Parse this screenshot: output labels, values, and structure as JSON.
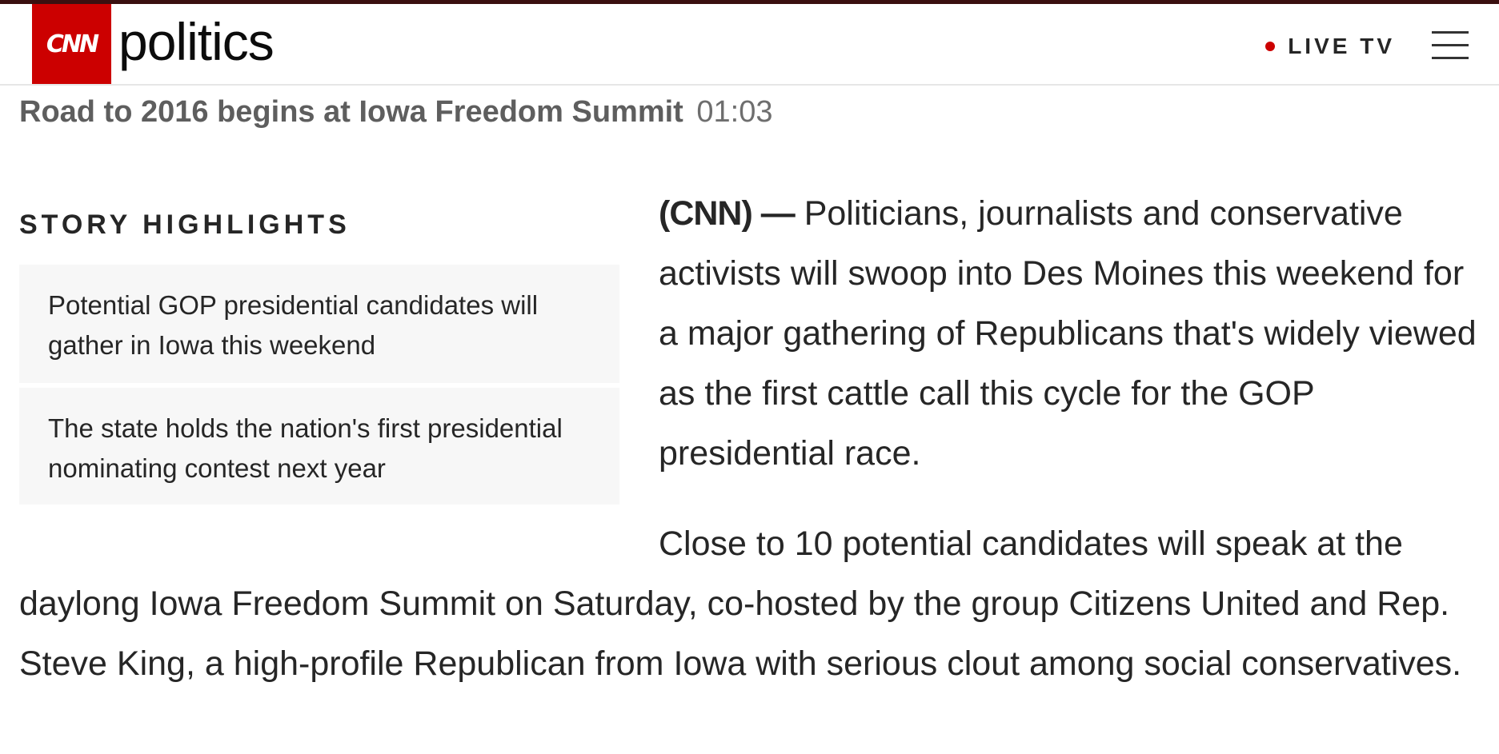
{
  "header": {
    "logo": "CNN",
    "section": "politics",
    "live_label": "LIVE TV",
    "menu_icon": "hamburger-menu-icon",
    "live_dot_color": "#cc0000",
    "brand_color": "#cc0000"
  },
  "video": {
    "title": "Road to 2016 begins at Iowa Freedom Summit",
    "duration": "01:03"
  },
  "highlights": {
    "heading": "STORY HIGHLIGHTS",
    "items": [
      "Potential GOP presidential candidates will gather in Iowa this weekend",
      "The state holds the nation's first presidential nominating contest next year"
    ]
  },
  "article": {
    "dateline": "(CNN) —",
    "paragraph1": "Politicians, journalists and conservative activists will swoop into Des Moines this weekend for a major gathering of Republicans that's widely viewed as the first cattle call this cycle for the GOP presidential race.",
    "paragraph2": "Close to 10 potential candidates will speak at the daylong Iowa Freedom Summit on Saturday, co-hosted by the group Citizens United and Rep. Steve King, a high-profile Republican from Iowa with serious clout among social conservatives."
  }
}
